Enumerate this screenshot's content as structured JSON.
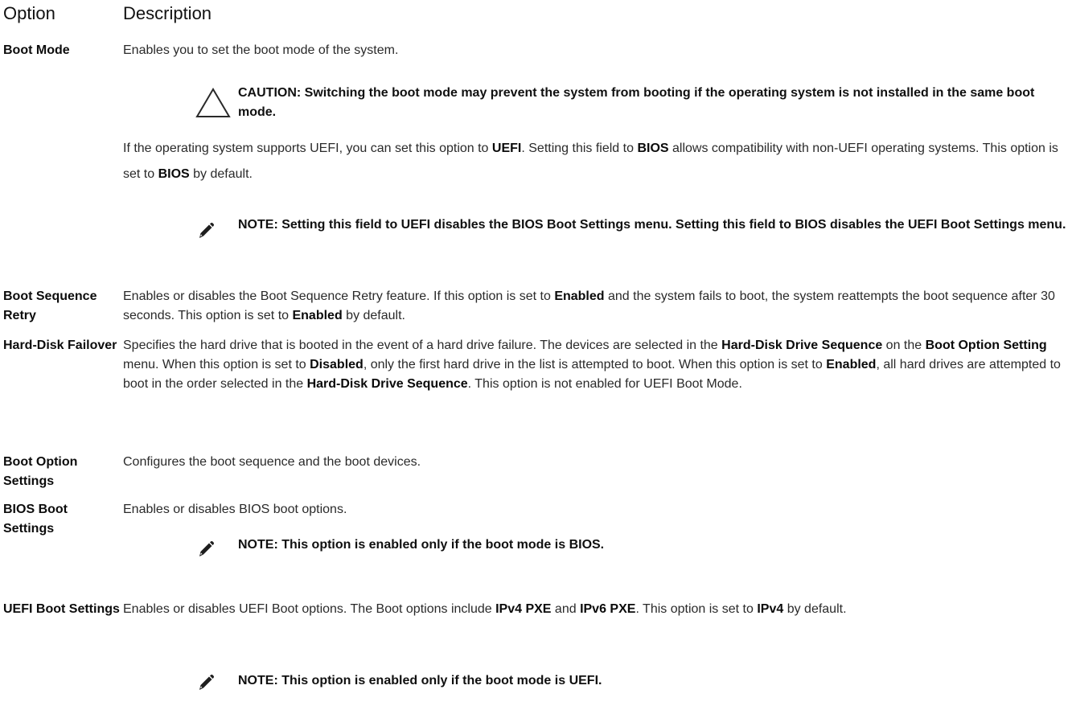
{
  "header": {
    "option": "Option",
    "description": "Description"
  },
  "rows": {
    "boot_mode": {
      "name": "Boot Mode",
      "desc": "Enables you to set the boot mode of the system.",
      "caution": "CAUTION: Switching the boot mode may prevent the system from booting if the operating system is not installed in the same boot mode.",
      "p2": {
        "a": "If the operating system supports UEFI, you can set this option to ",
        "b1": "UEFI",
        "c": ". Setting this field to ",
        "b2": "BIOS",
        "d": " allows compatibility with non-UEFI operating systems. This option is set to ",
        "b3": "BIOS",
        "e": " by default."
      },
      "note": "NOTE: Setting this field to UEFI disables the BIOS Boot Settings menu. Setting this field to BIOS disables the UEFI Boot Settings menu."
    },
    "boot_sequence_retry": {
      "name": "Boot Sequence Retry",
      "a": "Enables or disables the Boot Sequence Retry feature. If this option is set to ",
      "b1": "Enabled",
      "c": " and the system fails to boot, the system reattempts the boot sequence after 30 seconds. This option is set to ",
      "b2": "Enabled",
      "d": " by default."
    },
    "hard_disk_failover": {
      "name": "Hard-Disk Failover",
      "a": "Specifies the hard drive that is booted in the event of a hard drive failure. The devices are selected in the ",
      "b1": "Hard-Disk Drive Sequence",
      "c": " on the ",
      "b2": "Boot Option Setting",
      "d": " menu. When this option is set to ",
      "b3": "Disabled",
      "e": ", only the first hard drive in the list is attempted to boot. When this option is set to ",
      "b4": "Enabled",
      "f": ", all hard drives are attempted to boot in the order selected in the ",
      "b5": "Hard-Disk Drive Sequence",
      "g": ". This option is not enabled for UEFI Boot Mode."
    },
    "boot_option_settings": {
      "name": "Boot Option Settings",
      "desc": "Configures the boot sequence and the boot devices."
    },
    "bios_boot_settings": {
      "name": "BIOS Boot Settings",
      "desc": "Enables or disables BIOS boot options.",
      "note": "NOTE: This option is enabled only if the boot mode is BIOS."
    },
    "uefi_boot_settings": {
      "name": "UEFI Boot Settings",
      "a": "Enables or disables UEFI Boot options. The Boot options include ",
      "b1": "IPv4 PXE",
      "c": " and ",
      "b2": "IPv6 PXE",
      "d": ". This option is set to ",
      "b3": "IPv4",
      "e": " by default.",
      "note": "NOTE: This option is enabled only if the boot mode is UEFI."
    }
  },
  "icons": {
    "caution": "caution-triangle-icon",
    "note": "note-pencil-icon"
  }
}
